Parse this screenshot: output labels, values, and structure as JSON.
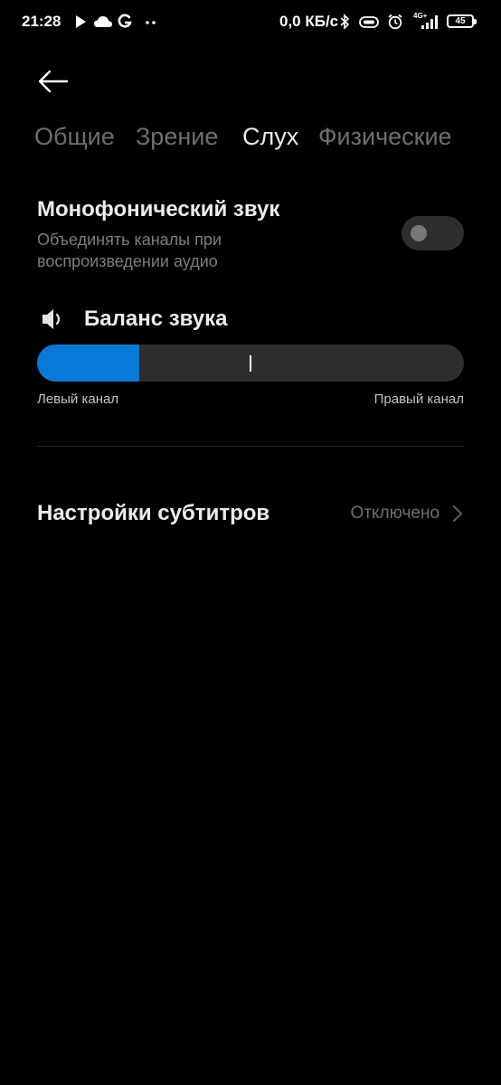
{
  "status_bar": {
    "time": "21:28",
    "speed": "0,0 КБ/с",
    "network": "4G+",
    "battery": "45",
    "icons": [
      "play-icon",
      "cloud-icon",
      "google-icon",
      "more-dots-icon",
      "bluetooth-icon",
      "vibrate-icon",
      "alarm-icon",
      "signal-icon"
    ]
  },
  "tabs": [
    {
      "label": "Общие",
      "active": false
    },
    {
      "label": "Зрение",
      "active": false
    },
    {
      "label": "Слух",
      "active": true
    },
    {
      "label": "Физические",
      "active": false
    }
  ],
  "mono_audio": {
    "title": "Монофонический звук",
    "description": "Объединять каналы при воспроизведении аудио",
    "enabled": false
  },
  "balance": {
    "title": "Баланс звука",
    "left_label": "Левый канал",
    "right_label": "Правый канал",
    "fill_fraction": 0.24
  },
  "subtitles": {
    "title": "Настройки субтитров",
    "value": "Отключено"
  },
  "colors": {
    "accent": "#0a78d6",
    "background": "#000000",
    "track": "#2e2e2e"
  }
}
